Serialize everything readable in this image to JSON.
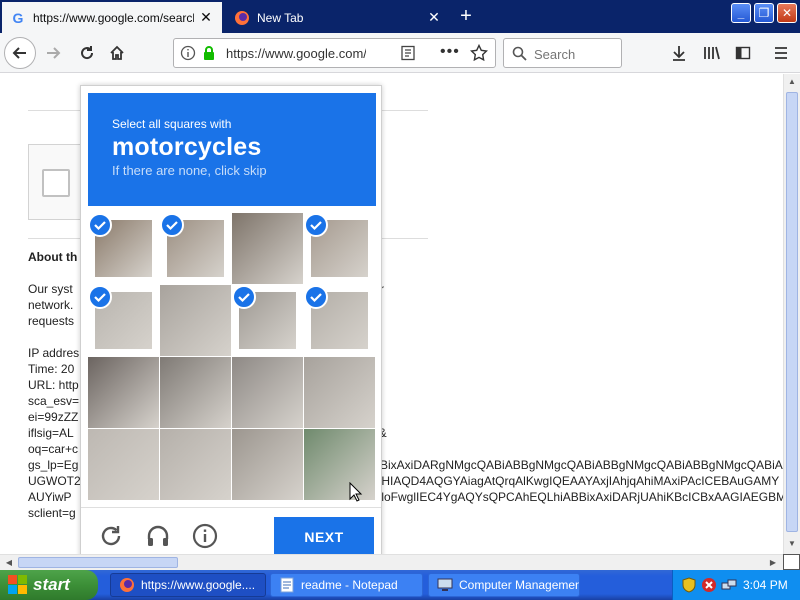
{
  "tabs": [
    {
      "label": "https://www.google.com/search?q=",
      "icon": "google-favicon"
    },
    {
      "label": "New Tab",
      "icon": "firefox-favicon"
    }
  ],
  "google_favicon_letter": "G",
  "navbar": {
    "url": "https://www.google.com/search?",
    "search_placeholder": "Search"
  },
  "page": {
    "about_heading": "About th",
    "lines": [
      "Our syst",
      "network.",
      "requests",
      "",
      "IP addres",
      "Time: 20",
      "URL: http",
      "sca_esv=",
      "ei=99zZZ",
      "iflsig=AL",
      "oq=car+c",
      "gs_lp=Eg",
      "UGWOT2",
      "AUYiwP",
      "sclient=g"
    ],
    "right_fragments": [
      {
        "text": "r",
        "row": 0
      },
      {
        "text": "1&",
        "row": 9
      },
      {
        "text": "BBixAxiDARgNMgcQABiABBgNMgcQABiABBgNMgcQABiABBgNMgcQABiABBgNMgcQA",
        "row": 11
      },
      {
        "text": "QHIAQD4AQGYAiagAtQrqAlKwgIQEAAYAxjIAhjqAhiMAxiPAcICEBAuGAMY",
        "row": 12
      },
      {
        "text": "GloFwglIEC4YgAQYsQPCAhEQLhiABBixAxiDARjUAhiKBcICBxAAGIAEGBM",
        "row": 13
      }
    ]
  },
  "captcha": {
    "instruction": "Select all squares with",
    "object": "motorcycles",
    "hint": "If there are none, click skip",
    "next_label": "NEXT",
    "selected_tiles": [
      0,
      1,
      3,
      4,
      6,
      7
    ],
    "tile_count": 16
  },
  "taskbar": {
    "start_label": "start",
    "tasks": [
      {
        "label": "https://www.google....",
        "icon": "firefox-icon"
      },
      {
        "label": "readme - Notepad",
        "icon": "notepad-icon"
      },
      {
        "label": "Computer Management",
        "icon": "computer-management-icon"
      }
    ],
    "clock": "3:04 PM"
  },
  "colors": {
    "captcha_blue": "#1a73e8",
    "titlebar_blue": "#0a246a",
    "taskbar_blue": "#245edb",
    "start_green": "#3c8f37"
  }
}
